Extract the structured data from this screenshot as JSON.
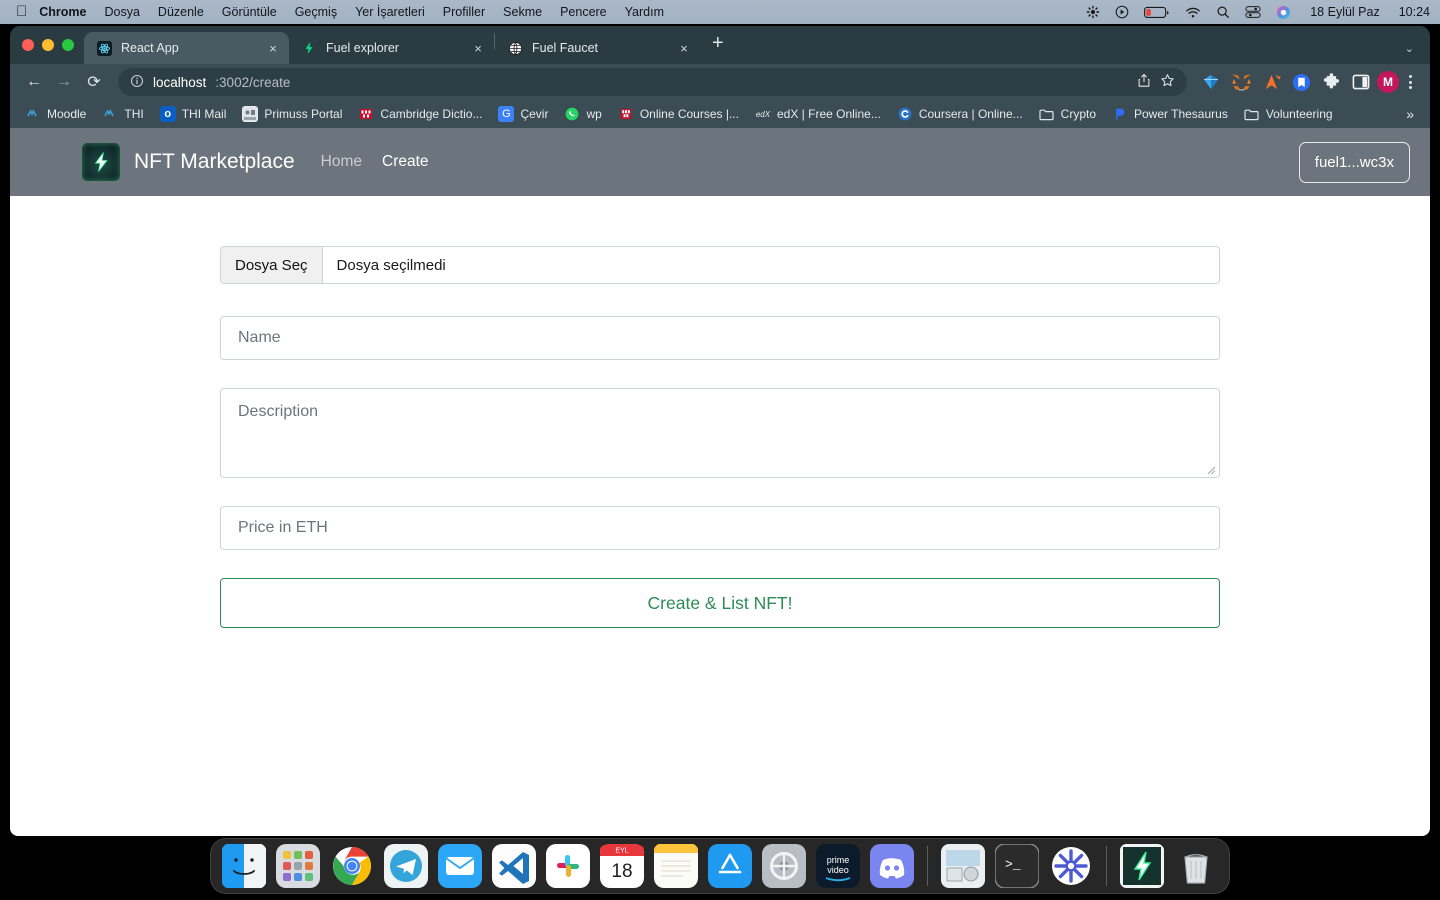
{
  "menubar": {
    "apple_icon": "apple-icon",
    "items": [
      {
        "label": "Chrome",
        "bold": true
      },
      {
        "label": "Dosya",
        "bold": false
      },
      {
        "label": "Düzenle",
        "bold": false
      },
      {
        "label": "Görüntüle",
        "bold": false
      },
      {
        "label": "Geçmiş",
        "bold": false
      },
      {
        "label": "Yer İşaretleri",
        "bold": false
      },
      {
        "label": "Profiller",
        "bold": false
      },
      {
        "label": "Sekme",
        "bold": false
      },
      {
        "label": "Pencere",
        "bold": false
      },
      {
        "label": "Yardım",
        "bold": false
      }
    ],
    "status_icons": [
      "flower-icon",
      "play-circle-icon",
      "battery-icon",
      "wifi-icon",
      "search-icon",
      "control-center-icon",
      "siri-icon"
    ],
    "date": "18 Eylül Paz",
    "time": "10:24"
  },
  "browser": {
    "tabs": [
      {
        "title": "React App",
        "favicon": "react-icon",
        "active": true,
        "close": "×"
      },
      {
        "title": "Fuel explorer",
        "favicon": "fuel-bolt-icon",
        "active": false,
        "close": "×"
      },
      {
        "title": "Fuel Faucet",
        "favicon": "globe-icon",
        "active": false,
        "close": "×"
      }
    ],
    "new_tab_label": "+",
    "tab_list_caret": "⌄",
    "nav": {
      "back": "←",
      "forward": "→",
      "reload": "⟳"
    },
    "omnibox": {
      "info_icon": "info-circle-icon",
      "host": "localhost",
      "path": ":3002/create",
      "share_icon": "share-icon",
      "bookmark_star_icon": "star-icon"
    },
    "extensions": [
      "fuel-wallet-icon",
      "metamask-icon",
      "phantom-icon",
      "pocket-icon",
      "puzzle-icon",
      "side-panel-icon"
    ],
    "profile_initial": "M",
    "menu_icon": "kebab-menu-icon",
    "bookmarks": [
      {
        "label": "Moodle",
        "icon": "thi-icon"
      },
      {
        "label": "THI",
        "icon": "thi-icon"
      },
      {
        "label": "THI Mail",
        "icon": "outlook-icon"
      },
      {
        "label": "Primuss Portal",
        "icon": "primuss-icon"
      },
      {
        "label": "Cambridge Dictio...",
        "icon": "cambridge-icon"
      },
      {
        "label": "Çevir",
        "icon": "google-translate-icon"
      },
      {
        "label": "wp",
        "icon": "whatsapp-icon"
      },
      {
        "label": "Online Courses |...",
        "icon": "udacity-icon"
      },
      {
        "label": "edX | Free Online...",
        "icon": "edx-icon"
      },
      {
        "label": "Coursera | Online...",
        "icon": "coursera-icon"
      },
      {
        "label": "Crypto",
        "icon": "folder-icon"
      },
      {
        "label": "Power Thesaurus",
        "icon": "power-thesaurus-icon"
      },
      {
        "label": "Volunteering",
        "icon": "folder-icon"
      }
    ],
    "bookmarks_overflow": "»"
  },
  "app": {
    "logo_icon": "lightning-bolt-logo",
    "title": "NFT Marketplace",
    "nav": {
      "home": "Home",
      "create": "Create"
    },
    "wallet": "fuel1...wc3x",
    "form": {
      "file_button": "Dosya Seç",
      "file_status": "Dosya seçilmedi",
      "name_placeholder": "Name",
      "description_placeholder": "Description",
      "price_placeholder": "Price in ETH",
      "submit_label": "Create & List NFT!"
    },
    "colors": {
      "header_bg": "#6c757d",
      "accent_green": "#2e8b57",
      "border": "#ced4da"
    }
  },
  "dock": {
    "items": [
      {
        "name": "finder",
        "running": true
      },
      {
        "name": "launchpad",
        "running": false
      },
      {
        "name": "chrome",
        "running": true
      },
      {
        "name": "telegram",
        "running": false
      },
      {
        "name": "mail",
        "running": false
      },
      {
        "name": "vscode",
        "running": true
      },
      {
        "name": "slack",
        "running": false
      },
      {
        "name": "calendar",
        "running": false,
        "month": "EYL",
        "day": "18"
      },
      {
        "name": "notes",
        "running": true
      },
      {
        "name": "app-store",
        "running": false
      },
      {
        "name": "system-settings",
        "running": false
      },
      {
        "name": "prime-video",
        "running": false
      },
      {
        "name": "discord",
        "running": false
      },
      {
        "name": "preview",
        "running": false
      },
      {
        "name": "terminal",
        "running": false
      },
      {
        "name": "sunburst-app",
        "running": false
      },
      {
        "name": "fuel-app",
        "running": false
      },
      {
        "name": "trash",
        "running": false
      }
    ]
  }
}
